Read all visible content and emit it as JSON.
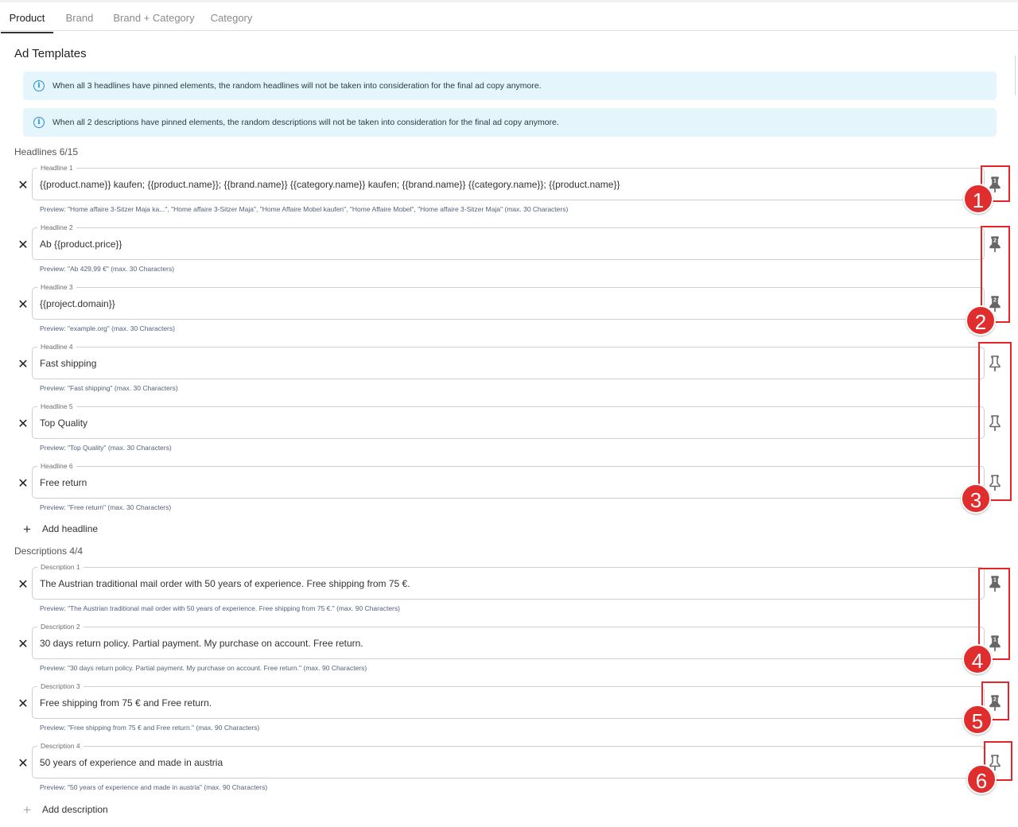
{
  "tabs": [
    "Product",
    "Brand",
    "Brand + Category",
    "Category"
  ],
  "page_title": "Ad Templates",
  "info": {
    "icon": "info-icon",
    "headlines_note": "When all 3 headlines have pinned elements, the random headlines will not be taken into consideration for the final ad copy anymore.",
    "descriptions_note": "When all 2 descriptions have pinned elements, the random descriptions will not be taken into consideration for the final ad copy anymore."
  },
  "headlines": {
    "title": "Headlines 6/15",
    "add_label": "Add headline",
    "items": [
      {
        "label": "Headline 1",
        "value": "{{product.name}} kaufen; {{product.name}}; {{brand.name}} {{category.name}} kaufen; {{brand.name}} {{category.name}}; {{product.name}}",
        "preview": "Preview: \"Home affaire 3-Sitzer Maja ka...\", \"Home affaire 3-Sitzer Maja\", \"Home Affaire Mobel kaufen\", \"Home Affaire Mobel\", \"Home affaire 3-Sitzer Maja\" (max. 30 Characters)",
        "pin": "1"
      },
      {
        "label": "Headline 2",
        "value": "Ab {{product.price}}",
        "preview": "Preview: \"Ab 429,99 €\" (max. 30 Characters)",
        "pin": "2"
      },
      {
        "label": "Headline 3",
        "value": "{{project.domain}}",
        "preview": "Preview: \"example.org\" (max. 30 Characters)",
        "pin": "2"
      },
      {
        "label": "Headline 4",
        "value": "Fast shipping",
        "preview": "Preview: \"Fast shipping\" (max. 30 Characters)",
        "pin": ""
      },
      {
        "label": "Headline 5",
        "value": "Top Quality",
        "preview": "Preview: \"Top Quality\" (max. 30 Characters)",
        "pin": ""
      },
      {
        "label": "Headline 6",
        "value": "Free return",
        "preview": "Preview: \"Free return\" (max. 30 Characters)",
        "pin": ""
      }
    ]
  },
  "descriptions": {
    "title": "Descriptions 4/4",
    "add_label": "Add description",
    "items": [
      {
        "label": "Description 1",
        "value": "The Austrian traditional mail order with 50 years of experience. Free shipping from 75 €.",
        "preview": "Preview: \"The Austrian traditional mail order with 50 years of experience. Free shipping from 75 €.\" (max. 90 Characters)",
        "pin": "1"
      },
      {
        "label": "Description 2",
        "value": "30 days return policy. Partial payment. My purchase on account. Free return.",
        "preview": "Preview: \"30 days return policy. Partial payment. My purchase on account. Free return.\" (max. 90 Characters)",
        "pin": "1"
      },
      {
        "label": "Description 3",
        "value": "Free shipping from 75 € and Free return.",
        "preview": "Preview: \"Free shipping from 75 € and Free return.\" (max. 90 Characters)",
        "pin": "2"
      },
      {
        "label": "Description 4",
        "value": "50 years of experience and made in austria",
        "preview": "Preview: \"50 years of experience and made in austria\" (max. 90 Characters)",
        "pin": ""
      }
    ]
  },
  "annotations": [
    "1",
    "2",
    "3",
    "4",
    "5",
    "6"
  ],
  "colors": {
    "annotation": "#e02d2d",
    "info_bg": "#e4f5fb",
    "info_icon": "#2b8fd0"
  },
  "icons": {
    "remove": "close-icon",
    "pin": "pin-icon",
    "add": "plus-icon"
  }
}
